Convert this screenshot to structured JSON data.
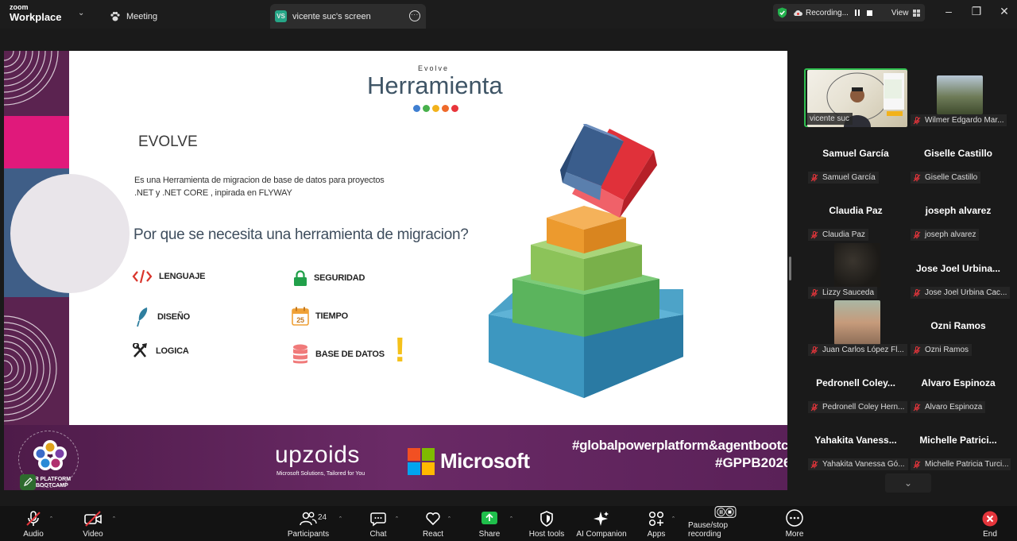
{
  "titlebar": {
    "app_logo_top": "zoom",
    "app_logo_bottom": "Workplace",
    "tab_meeting": "Meeting",
    "tab_screen_badge": "VS",
    "tab_screen": "vicente suc's screen",
    "recording_status": "Recording...",
    "view_label": "View"
  },
  "slide": {
    "evolve_small": "Evolve",
    "title": "Herramienta",
    "heading": "EVOLVE",
    "description_line1": "Es una Herramienta de migracion de base de datos para proyectos",
    "description_line2": ".NET y .NET CORE , inpirada en FLYWAY",
    "question": "Por que se necesita una herramienta de migracion?",
    "features": {
      "lenguaje": "LENGUAJE",
      "seguridad": "SEGURIDAD",
      "diseno": "DISEÑO",
      "tiempo": "TIEMPO",
      "logica": "LOGICA",
      "base_datos": "BASE DE DATOS"
    },
    "calendar_day": "25",
    "exclamation": "!",
    "dot_colors": [
      "#3f7fd1",
      "#47b04b",
      "#f2b21c",
      "#ef6a2b",
      "#e8353b"
    ],
    "footer": {
      "bootcamp_text_1": "ER PLATFORM",
      "bootcamp_text_2": "BOOTCAMP",
      "upzoids": "upzoids",
      "upzoids_tagline": "Microsoft Solutions, Tailored for You",
      "microsoft": "Microsoft",
      "hashtag1": "#globalpowerplatform&agentbootcamp",
      "hashtag2": "#GPPB2026"
    }
  },
  "participants": [
    {
      "label": "vicente suc",
      "video": true,
      "speaker": true
    },
    {
      "label": "Wilmer Edgardo Mar...",
      "video": true
    },
    {
      "name": "Samuel García",
      "label": "Samuel García"
    },
    {
      "name": "Giselle Castillo",
      "label": "Giselle Castillo"
    },
    {
      "name": "Claudia Paz",
      "label": "Claudia Paz"
    },
    {
      "name": "joseph alvarez",
      "label": "joseph alvarez"
    },
    {
      "label": "Lizzy Sauceda",
      "video": true
    },
    {
      "name": "Jose Joel Urbina...",
      "label": "Jose Joel Urbina Cac..."
    },
    {
      "label": "Juan Carlos López Fl...",
      "video": true
    },
    {
      "name": "Ozni Ramos",
      "label": "Ozni Ramos"
    },
    {
      "name": "Pedronell Coley...",
      "label": "Pedronell Coley Hern..."
    },
    {
      "name": "Alvaro Espinoza",
      "label": "Alvaro Espinoza"
    },
    {
      "name": "Yahakita Vaness...",
      "label": "Yahakita Vanessa Gó..."
    },
    {
      "name": "Michelle Patrici...",
      "label": "Michelle Patricia Turci..."
    }
  ],
  "toolbar": {
    "audio": "Audio",
    "video": "Video",
    "participants": "Participants",
    "participants_count": "24",
    "chat": "Chat",
    "react": "React",
    "share": "Share",
    "host_tools": "Host tools",
    "ai_companion": "AI Companion",
    "apps": "Apps",
    "pause_stop_recording": "Pause/stop recording",
    "more": "More",
    "end": "End"
  }
}
